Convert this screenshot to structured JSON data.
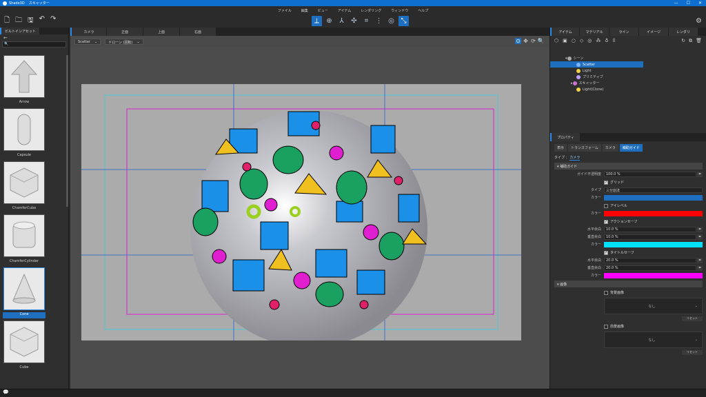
{
  "app": {
    "name": "Shade3D",
    "window_title": "スキャッター",
    "controls": [
      "—",
      "☐",
      "✕"
    ]
  },
  "menu": [
    "ファイル",
    "編集",
    "ビュー",
    "アイテム",
    "レンダリング",
    "ウィンドウ",
    "ヘルプ"
  ],
  "left_panel": {
    "tab": "ビルトインアセット",
    "assets": [
      {
        "label": "Arrow"
      },
      {
        "label": "Capsule"
      },
      {
        "label": "ChamferCube"
      },
      {
        "label": "ChamferCylinder"
      },
      {
        "label": "Cone",
        "selected": true
      },
      {
        "label": "Cube"
      }
    ]
  },
  "viewport": {
    "tabs": [
      "カメラ",
      "正面",
      "上面",
      "右面"
    ],
    "camera_dropdown": "Scatter",
    "drone_dropdown": "ドローン (回転)"
  },
  "right_panel": {
    "tabs": [
      "アイテム",
      "マテリアル",
      "ライン",
      "イメージ",
      "レンダリ"
    ],
    "tree": [
      {
        "label": "シーン",
        "indent": 0,
        "icon_color": "#aaaaaa"
      },
      {
        "label": "Scatter",
        "indent": 2,
        "icon_color": "#7fb5ff",
        "selected": true
      },
      {
        "label": "Light",
        "indent": 2,
        "icon_color": "#f2d34a"
      },
      {
        "label": "プリミティブ",
        "indent": 2,
        "icon_color": "#bfa0ff"
      },
      {
        "label": "スキャッター",
        "indent": 2,
        "icon_color": "#d070d0"
      },
      {
        "label": "Light(Clone)",
        "indent": 2,
        "icon_color": "#f2d34a"
      }
    ],
    "properties": {
      "tab": "プロパティ",
      "subtabs": [
        "表示",
        "トランスフォーム",
        "カメラ",
        "補助ガイド"
      ],
      "active_subtab": "補助ガイド",
      "type_label": "タイプ :",
      "type_value": "カメラ",
      "section_guides": "補助ガイド",
      "guide_opacity_label": "ガイド不透明度",
      "guide_opacity": "100.0 %",
      "grid_label": "グリッド",
      "grid_type_label": "タイプ",
      "grid_type": "三分割法",
      "color_label": "カラー",
      "grid_color": "#1f6fc0",
      "eyelevel_label": "アイレベル",
      "eyelevel_color": "#ff0000",
      "action_safe_label": "アクションセーフ",
      "h_label": "水平余白",
      "v_label": "垂直余白",
      "action_h": "10.0 %",
      "action_v": "10.0 %",
      "action_color": "#00e0ff",
      "title_safe_label": "タイトルセーフ",
      "title_h": "20.0 %",
      "title_v": "20.0 %",
      "title_color": "#ff00ff",
      "section_bg": "画像",
      "bg_label": "背景画像",
      "fg_label": "前景画像",
      "none": "なし",
      "reset": "リセット"
    }
  }
}
